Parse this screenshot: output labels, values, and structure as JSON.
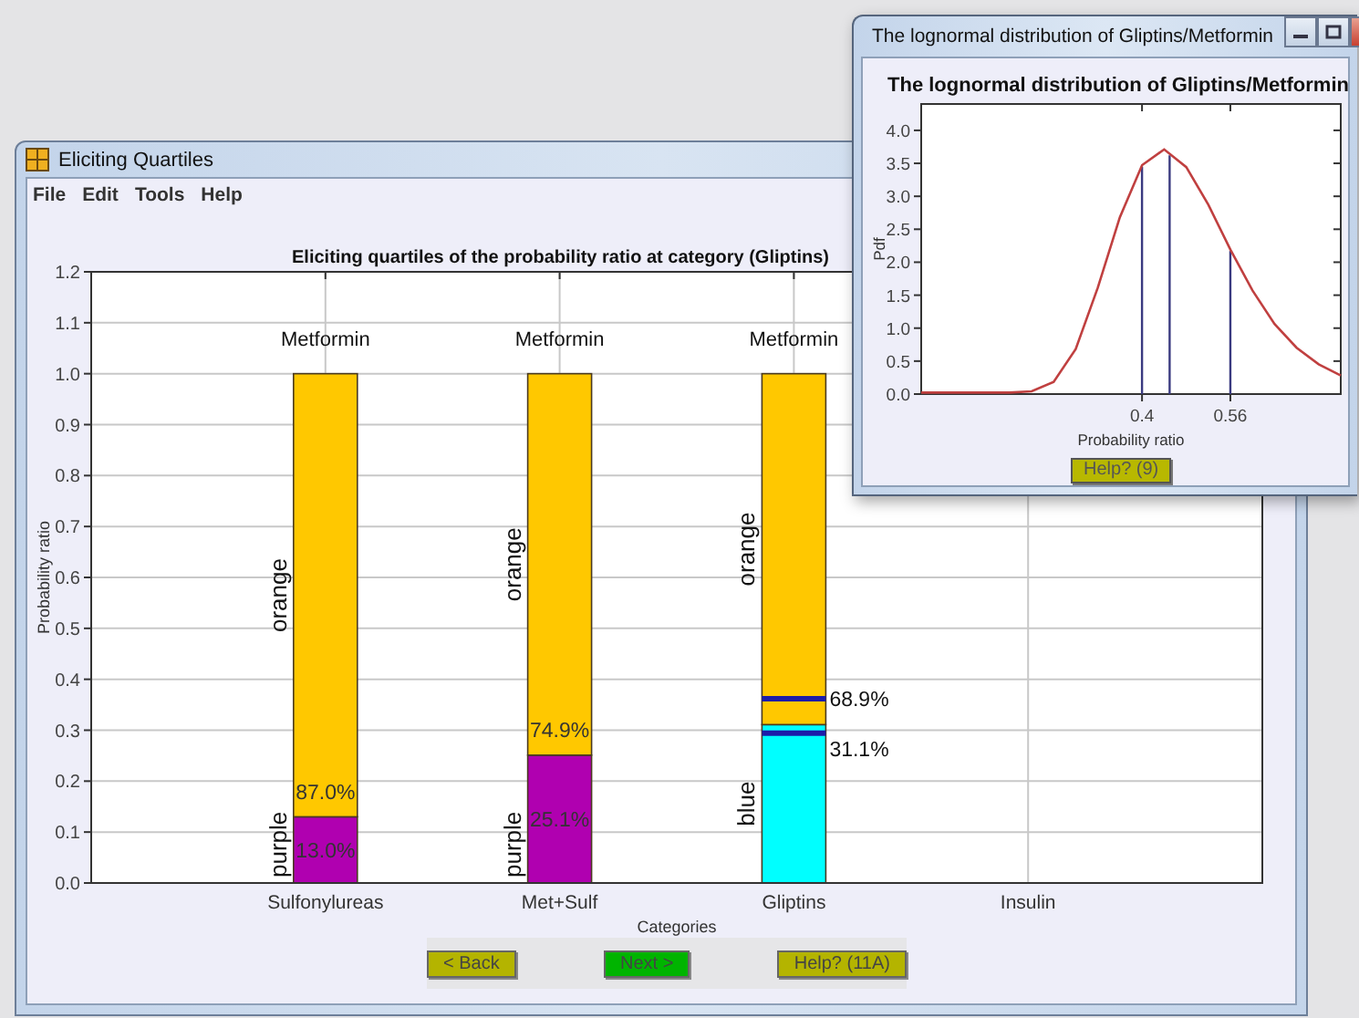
{
  "main_window": {
    "title": "Eliciting Quartiles",
    "menu": [
      "File",
      "Edit",
      "Tools",
      "Help"
    ],
    "chart_data": {
      "type": "bar",
      "title": "Eliciting quartiles of the probability ratio at category (Gliptins)",
      "xlabel": "Categories",
      "ylabel": "Probability ratio",
      "categories": [
        "Sulfonylureas",
        "Met+Sulf",
        "Gliptins",
        "Insulin"
      ],
      "series": [
        {
          "name": "purple",
          "color": "#b000b0",
          "values": [
            0.13,
            0.251,
            null,
            null
          ]
        },
        {
          "name": "blue",
          "color": "#00ffff",
          "values": [
            null,
            null,
            0.311,
            null
          ]
        },
        {
          "name": "orange",
          "color": "#ffc800",
          "values": [
            0.87,
            0.749,
            0.689,
            null
          ]
        }
      ],
      "stacked": true,
      "grid": true,
      "ylim": [
        0,
        1.2
      ],
      "yticks": [
        {
          "value": 0,
          "label": "0.0"
        },
        {
          "value": 0.1,
          "label": "0.1"
        },
        {
          "value": 0.2,
          "label": "0.2"
        },
        {
          "value": 0.3,
          "label": "0.3"
        },
        {
          "value": 0.4,
          "label": "0.4"
        },
        {
          "value": 0.5,
          "label": "0.5"
        },
        {
          "value": 0.6,
          "label": "0.6"
        },
        {
          "value": 0.7,
          "label": "0.7"
        },
        {
          "value": 0.8,
          "label": "0.8"
        },
        {
          "value": 0.9,
          "label": "0.9"
        },
        {
          "value": 1.0,
          "label": "1.0"
        },
        {
          "value": 1.1,
          "label": "1.1"
        },
        {
          "value": 1.2,
          "label": "1.2"
        }
      ]
    },
    "bar_labels": [
      {
        "top": "Metformin",
        "values": [
          "87.0%",
          "13.0%"
        ]
      },
      {
        "top": "Metformin",
        "values": [
          "74.9%",
          "25.1%"
        ]
      },
      {
        "top": "Metformin",
        "markers": [
          "68.9%",
          "31.1%"
        ]
      }
    ],
    "buttons": [
      {
        "kind": "back",
        "label": "< Back"
      },
      {
        "kind": "next",
        "label": "Next >"
      },
      {
        "kind": "help",
        "label": "Help? (11A)"
      }
    ]
  },
  "dist_window": {
    "title": "The lognormal distribution of Gliptins/Metformin",
    "chart_data": {
      "type": "line",
      "title": "The lognormal distribution of Gliptins/Metformin",
      "xlabel": "Probability ratio",
      "ylabel": "Pdf",
      "x": [
        0,
        0.04,
        0.08,
        0.12,
        0.16,
        0.2,
        0.24,
        0.28,
        0.32,
        0.36,
        0.4,
        0.44,
        0.48,
        0.52,
        0.56,
        0.6,
        0.64,
        0.68,
        0.72,
        0.76
      ],
      "series": [
        {
          "color": "#c04040",
          "values": [
            0,
            0,
            0,
            0,
            0,
            0.02,
            0.16,
            0.66,
            1.59,
            2.66,
            3.45,
            3.69,
            3.42,
            2.85,
            2.17,
            1.55,
            1.04,
            0.68,
            0.43,
            0.26
          ]
        }
      ],
      "xlim": [
        0,
        0.76
      ],
      "ylim": [
        0,
        4.4
      ],
      "xticks": [
        0.4,
        0.56
      ],
      "yticks": [
        {
          "value": 0,
          "label": "0.0"
        },
        {
          "value": 0.5,
          "label": "0.5"
        },
        {
          "value": 1,
          "label": "1.0"
        },
        {
          "value": 1.5,
          "label": "1.5"
        },
        {
          "value": 2,
          "label": "2.0"
        },
        {
          "value": 2.5,
          "label": "2.5"
        },
        {
          "value": 3,
          "label": "3.0"
        },
        {
          "value": 3.5,
          "label": "3.5"
        },
        {
          "value": 4,
          "label": "4.0"
        }
      ],
      "ref_lines": [
        {
          "axis": "x",
          "value": 0.4
        },
        {
          "axis": "x",
          "value": 0.45
        },
        {
          "axis": "x",
          "value": 0.56
        }
      ]
    },
    "button": "Help? (9)"
  }
}
